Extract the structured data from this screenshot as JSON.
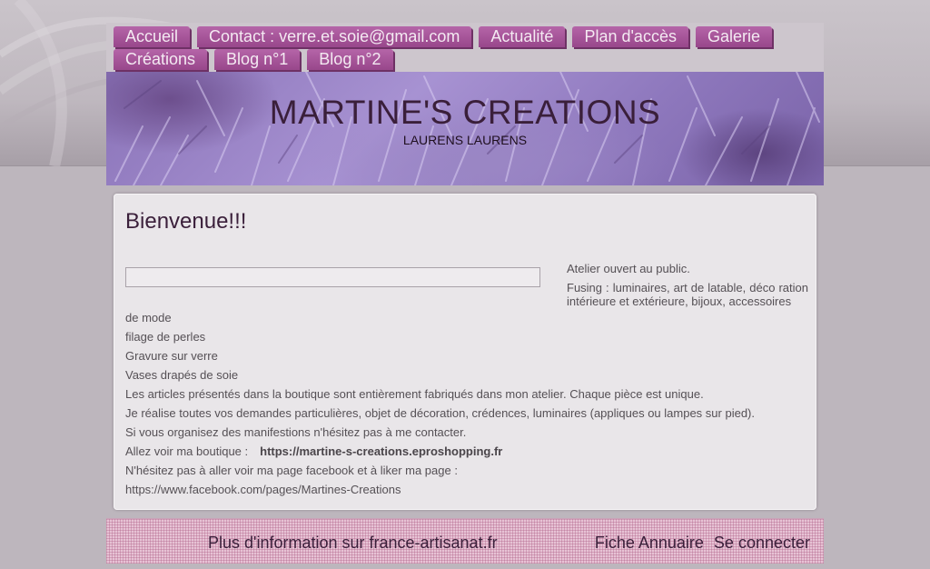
{
  "nav": {
    "row1": [
      "Accueil",
      "Contact : verre.et.soie@gmail.com",
      "Actualité",
      "Plan d'accès",
      "Galerie"
    ],
    "row2": [
      "Créations",
      "Blog n°1",
      "Blog n°2"
    ]
  },
  "header": {
    "title": "MARTINE'S CREATIONS",
    "subtitle": "LAURENS LAURENS"
  },
  "main": {
    "title": "Bienvenue!!!",
    "side": [
      "Atelier ouvert au public.",
      "Fusing : luminaires, art de latable, déco ration intérieure et extérieure, bijoux, accessoires"
    ],
    "lines": [
      "de mode",
      "filage de perles",
      "Gravure sur verre",
      "Vases drapés de soie",
      "Les articles présentés dans la boutique sont entièrement fabriqués dans mon atelier.  Chaque pièce est unique.",
      "Je réalise toutes vos demandes particulières, objet de décoration, crédences, luminaires (appliques ou lampes sur pied).",
      "Si vous organisez des manifestions n'hésitez pas à me contacter."
    ],
    "boutique_label": "Allez voir ma boutique :",
    "boutique_link": "https://martine-s-creations.eproshopping.fr",
    "facebook_text": "N'hésitez pas à aller voir ma page facebook et à liker ma page :",
    "facebook_link": "https://www.facebook.com/pages/Martines-Creations"
  },
  "footer": {
    "info": "Plus d'information sur france-artisanat.fr",
    "annuaire": "Fiche Annuaire",
    "login": "Se connecter"
  },
  "colors": {
    "tab": "#a9579c",
    "title": "#3a1f3a",
    "content_bg": "#e9e6e9",
    "footer_bg": "#e7c3d5"
  }
}
